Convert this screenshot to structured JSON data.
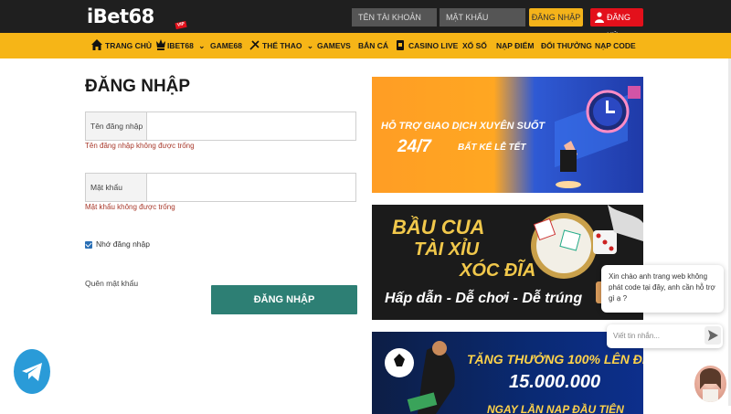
{
  "header": {
    "logo": "iBet68",
    "username_placeholder": "TÊN TÀI KHOẢN",
    "password_placeholder": "MẬT KHẨU",
    "login_label": "ĐĂNG NHẬP",
    "register_label": "ĐĂNG KÝ"
  },
  "nav": {
    "items": [
      "TRANG CHỦ",
      "IBET68",
      "GAME68",
      "THỂ THAO",
      "GAMEVS",
      "BẮN CÁ",
      "CASINO LIVE",
      "XỔ SỐ",
      "NẠP ĐIỂM",
      "ĐỔI THƯỞNG",
      "NẠP CODE"
    ],
    "badge": "VIP"
  },
  "form": {
    "title": "ĐĂNG NHẬP",
    "username_label": "Tên đăng nhập",
    "username_error": "Tên đăng nhập không được trống",
    "password_label": "Mật khẩu",
    "password_error": "Mật khẩu không được trống",
    "remember_label": "Nhớ đăng nhập",
    "forgot_label": "Quên mật khẩu",
    "submit_label": "ĐĂNG NHẬP"
  },
  "banners": {
    "b1_line1": "HỖ TRỢ GIAO DỊCH XUYÊN SUỐT",
    "b1_line2": "24/7",
    "b1_line3": "BẤT KỂ LỄ TẾT",
    "b2_line1": "BẦU CUA",
    "b2_line2": "TÀI XỈU",
    "b2_line3": "XÓC ĐĨA",
    "b2_line4": "Hấp dẫn - Dễ chơi - Dễ trúng",
    "b3_line1": "TẶNG THƯỞNG 100% LÊN ĐẾN",
    "b3_line2": "15.000.000",
    "b3_line3": "NGAY LẦN NẠP ĐẦU TIÊN"
  },
  "chat": {
    "message": "Xin chào anh trang web không phát code tại đây, anh cần hỗ trợ gì ạ ?",
    "input_placeholder": "Viết tin nhắn..."
  },
  "colors": {
    "topbar": "#1f1f1f",
    "nav": "#f6b517",
    "submit": "#2d7f74",
    "error": "#a8382a",
    "register": "#e3101b"
  }
}
